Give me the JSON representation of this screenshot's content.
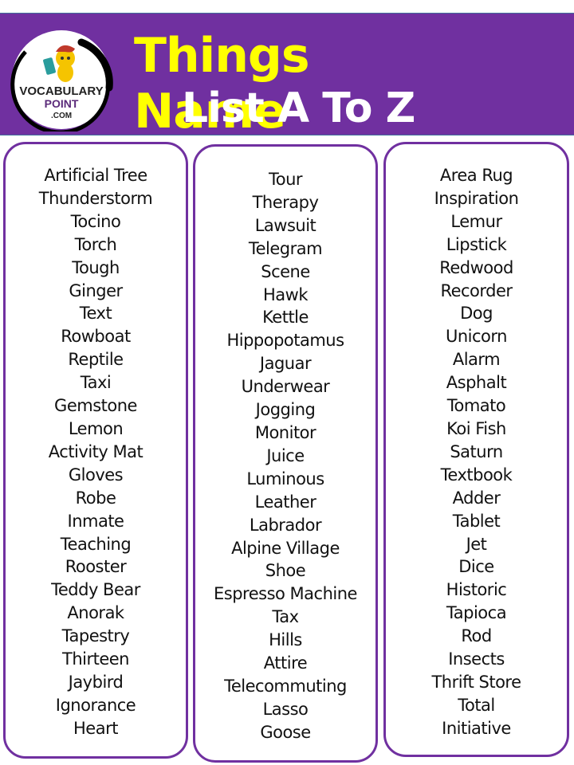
{
  "header": {
    "logo": {
      "line1": "VOCABULARY",
      "line2": "POINT",
      "line3": ".COM"
    },
    "title_line1": "Things Name",
    "title_line2": "List A To Z",
    "colors": {
      "banner": "#7030a0",
      "title_line1": "#ffff00",
      "title_line2": "#ffffff"
    }
  },
  "columns": [
    {
      "items": [
        "Artificial Tree",
        "Thunderstorm",
        "Tocino",
        "Torch",
        "Tough",
        "Ginger",
        "Text",
        "Rowboat",
        "Reptile",
        "Taxi",
        "Gemstone",
        "Lemon",
        "Activity Mat",
        "Gloves",
        "Robe",
        "Inmate",
        "Teaching",
        "Rooster",
        "Teddy Bear",
        "Anorak",
        "Tapestry",
        "Thirteen",
        "Jaybird",
        "Ignorance",
        "Heart"
      ]
    },
    {
      "items": [
        "Tour",
        "Therapy",
        "Lawsuit",
        "Telegram",
        "Scene",
        "Hawk",
        "Kettle",
        "Hippopotamus",
        "Jaguar",
        "Underwear",
        "Jogging",
        "Monitor",
        "Juice",
        "Luminous",
        "Leather",
        "Labrador",
        "Alpine Village",
        "Shoe",
        "Espresso Machine",
        "Tax",
        "Hills",
        "Attire",
        "Telecommuting",
        "Lasso",
        "Goose"
      ]
    },
    {
      "items": [
        "Area Rug",
        "Inspiration",
        "Lemur",
        "Lipstick",
        "Redwood",
        "Recorder",
        "Dog",
        "Unicorn",
        "Alarm",
        "Asphalt",
        "Tomato",
        "Koi Fish",
        "Saturn",
        "Textbook",
        "Adder",
        "Tablet",
        "Jet",
        "Dice",
        "Historic",
        "Tapioca",
        "Rod",
        "Insects",
        "Thrift Store",
        "Total",
        "Initiative"
      ]
    }
  ]
}
